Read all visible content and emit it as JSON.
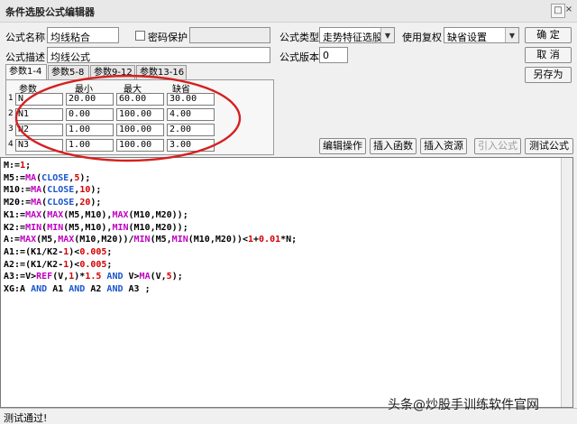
{
  "window": {
    "title": "条件选股公式编辑器",
    "close_glyph": "×"
  },
  "form": {
    "name_label": "公式名称",
    "name_value": "均线粘合",
    "password_label": "密码保护",
    "desc_label": "公式描述",
    "desc_value": "均线公式",
    "type_label": "公式类型",
    "type_value": "走势特征选股",
    "reuse_label": "使用复权",
    "reuse_value": "缺省设置",
    "version_label": "公式版本",
    "version_value": "0"
  },
  "buttons": {
    "ok": "确  定",
    "cancel": "取  消",
    "save_as": "另存为",
    "edit_ops": "编辑操作",
    "insert_func": "插入函数",
    "insert_resource": "插入资源",
    "import_formula": "引入公式",
    "test_formula": "测试公式"
  },
  "tabs": [
    {
      "label": "参数1-4",
      "active": true
    },
    {
      "label": "参数5-8",
      "active": false
    },
    {
      "label": "参数9-12",
      "active": false
    },
    {
      "label": "参数13-16",
      "active": false
    }
  ],
  "params": {
    "headers": [
      "参数",
      "最小",
      "最大",
      "缺省"
    ],
    "rows": [
      {
        "num": "1",
        "name": "N",
        "min": "20.00",
        "max": "60.00",
        "default": "30.00"
      },
      {
        "num": "2",
        "name": "N1",
        "min": "0.00",
        "max": "100.00",
        "default": "4.00"
      },
      {
        "num": "3",
        "name": "N2",
        "min": "1.00",
        "max": "100.00",
        "default": "2.00"
      },
      {
        "num": "4",
        "name": "N3",
        "min": "1.00",
        "max": "100.00",
        "default": "3.00"
      }
    ]
  },
  "code_lines": [
    [
      [
        "M:=",
        "#000"
      ],
      [
        "1",
        "#d40000"
      ],
      [
        ";",
        "#000"
      ]
    ],
    [
      [
        "M5:=",
        "#000"
      ],
      [
        "MA",
        "#c000c0"
      ],
      [
        "(",
        "#000"
      ],
      [
        "CLOSE",
        "#1a55cc"
      ],
      [
        ",",
        "#000"
      ],
      [
        "5",
        "#d40000"
      ],
      [
        ");",
        "#000"
      ]
    ],
    [
      [
        "M10:=",
        "#000"
      ],
      [
        "MA",
        "#c000c0"
      ],
      [
        "(",
        "#000"
      ],
      [
        "CLOSE",
        "#1a55cc"
      ],
      [
        ",",
        "#000"
      ],
      [
        "10",
        "#d40000"
      ],
      [
        ");",
        "#000"
      ]
    ],
    [
      [
        "M20:=",
        "#000"
      ],
      [
        "MA",
        "#c000c0"
      ],
      [
        "(",
        "#000"
      ],
      [
        "CLOSE",
        "#1a55cc"
      ],
      [
        ",",
        "#000"
      ],
      [
        "20",
        "#d40000"
      ],
      [
        ");",
        "#000"
      ]
    ],
    [
      [
        "K1:=",
        "#000"
      ],
      [
        "MAX",
        "#c000c0"
      ],
      [
        "(",
        "#000"
      ],
      [
        "MAX",
        "#c000c0"
      ],
      [
        "(M5,M10),",
        "#000"
      ],
      [
        "MAX",
        "#c000c0"
      ],
      [
        "(M10,M20));",
        "#000"
      ]
    ],
    [
      [
        "K2:=",
        "#000"
      ],
      [
        "MIN",
        "#c000c0"
      ],
      [
        "(",
        "#000"
      ],
      [
        "MIN",
        "#c000c0"
      ],
      [
        "(M5,M10),",
        "#000"
      ],
      [
        "MIN",
        "#c000c0"
      ],
      [
        "(M10,M20));",
        "#000"
      ]
    ],
    [
      [
        "A:=",
        "#000"
      ],
      [
        "MAX",
        "#c000c0"
      ],
      [
        "(M5,",
        "#000"
      ],
      [
        "MAX",
        "#c000c0"
      ],
      [
        "(M10,M20))/",
        "#000"
      ],
      [
        "MIN",
        "#c000c0"
      ],
      [
        "(M5,",
        "#000"
      ],
      [
        "MIN",
        "#c000c0"
      ],
      [
        "(M10,M20))<",
        "#000"
      ],
      [
        "1",
        "#d40000"
      ],
      [
        "+",
        "#000"
      ],
      [
        "0.01",
        "#d40000"
      ],
      [
        "*N;",
        "#000"
      ]
    ],
    [
      [
        "A1:=(K1/K2-",
        "#000"
      ],
      [
        "1",
        "#d40000"
      ],
      [
        ")<",
        "#000"
      ],
      [
        "0.005",
        "#d40000"
      ],
      [
        ";",
        "#000"
      ]
    ],
    [
      [
        "A2:=(K1/K2-",
        "#000"
      ],
      [
        "1",
        "#d40000"
      ],
      [
        ")<",
        "#000"
      ],
      [
        "0.005",
        "#d40000"
      ],
      [
        ";",
        "#000"
      ]
    ],
    [
      [
        "A3:=V>",
        "#000"
      ],
      [
        "REF",
        "#c000c0"
      ],
      [
        "(V,",
        "#000"
      ],
      [
        "1",
        "#d40000"
      ],
      [
        ")*",
        "#000"
      ],
      [
        "1.5",
        "#d40000"
      ],
      [
        " ",
        "#000"
      ],
      [
        "AND",
        "#1a55cc"
      ],
      [
        " V>",
        "#000"
      ],
      [
        "MA",
        "#c000c0"
      ],
      [
        "(V,",
        "#000"
      ],
      [
        "5",
        "#d40000"
      ],
      [
        ");",
        "#000"
      ]
    ],
    [
      [
        "XG:A ",
        "#000"
      ],
      [
        "AND",
        "#1a55cc"
      ],
      [
        " A1 ",
        "#000"
      ],
      [
        "AND",
        "#1a55cc"
      ],
      [
        " A2 ",
        "#000"
      ],
      [
        "AND",
        "#1a55cc"
      ],
      [
        " A3 ;",
        "#000"
      ]
    ]
  ],
  "status": "测试通过!",
  "watermark": "头条@炒股手训练软件官网",
  "annotation_color": "#d42020"
}
